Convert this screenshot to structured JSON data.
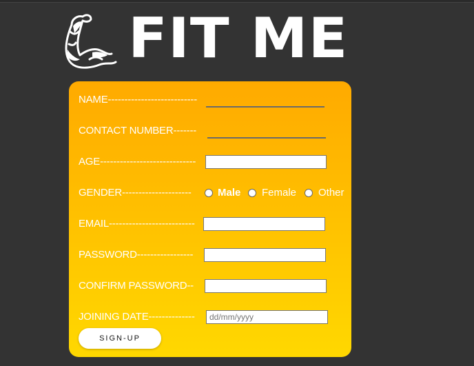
{
  "brand": {
    "title": "FIT ME",
    "icon": "flexed-arm-icon"
  },
  "form": {
    "name": {
      "label": "NAME---------------------------"
    },
    "contact": {
      "label": "CONTACT NUMBER-------"
    },
    "age": {
      "label": "AGE-----------------------------"
    },
    "gender": {
      "label": "GENDER---------------------",
      "options": [
        "Male",
        "Female",
        "Other"
      ]
    },
    "email": {
      "label": "EMAIL--------------------------"
    },
    "password": {
      "label": "PASSWORD-----------------"
    },
    "confirm": {
      "label": "CONFIRM PASSWORD--"
    },
    "joining": {
      "label": "JOINING DATE--------------",
      "placeholder": "dd/mm/yyyy"
    },
    "submit_label": "SIGN-UP"
  },
  "colors": {
    "background": "#333333",
    "card_top": "#ffaa00",
    "card_bottom": "#ffd800"
  }
}
